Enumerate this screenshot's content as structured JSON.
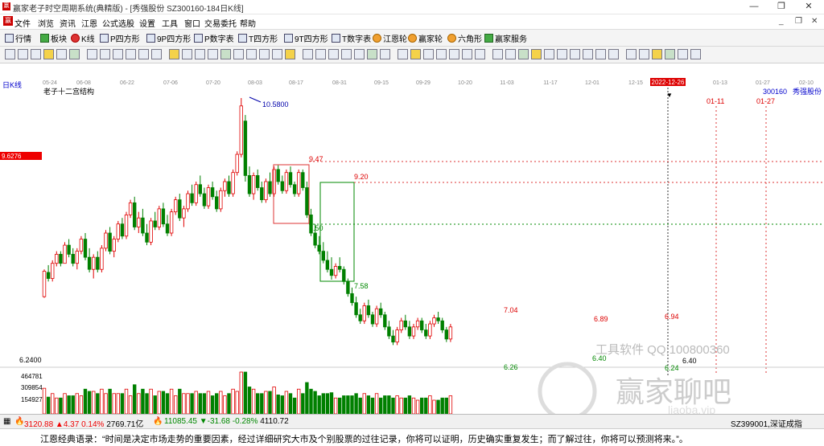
{
  "window": {
    "title": "赢家老子时空周期系统(典精版) - [秀强股份  SZ300160-184日K线]",
    "min_label": "—",
    "max_label": "❐",
    "close_label": "✕"
  },
  "menu": {
    "logo": "赢",
    "items": [
      "文件",
      "浏览",
      "资讯",
      "江恩",
      "公式选股",
      "设置",
      "工具",
      "窗口",
      "交易委托",
      "帮助"
    ]
  },
  "toolbar": {
    "buttons": [
      {
        "label": "行情",
        "icon": "grid-icon"
      },
      {
        "label": "板块",
        "icon": "blocks-icon"
      },
      {
        "label": "K线",
        "icon": "candles-icon"
      },
      {
        "label": "P四方形",
        "icon": "p-square-icon"
      },
      {
        "label": "9P四方形",
        "icon": "9p-square-icon"
      },
      {
        "label": "P数字表",
        "icon": "p-table-icon"
      },
      {
        "label": "T四方形",
        "icon": "t-square-icon"
      },
      {
        "label": "9T四方形",
        "icon": "9t-square-icon"
      },
      {
        "label": "T数字表",
        "icon": "t-table-icon"
      },
      {
        "label": "江恩轮",
        "icon": "gann-wheel-icon"
      },
      {
        "label": "赢家轮",
        "icon": "winner-wheel-icon"
      },
      {
        "label": "六角形",
        "icon": "hexagon-icon"
      },
      {
        "label": "赢家服务",
        "icon": "service-icon"
      }
    ]
  },
  "chart": {
    "period_label": "日K线",
    "structure_label": "老子十二宫结构",
    "stock_code": "300160",
    "stock_name": "秀强股份",
    "current_date_badge": "2022-12-26",
    "date_ticks": [
      "05-24",
      "06-08",
      "06-22",
      "07-06",
      "07-20",
      "08-03",
      "08-17",
      "08-31",
      "09-15",
      "09-29",
      "10-20",
      "11-03",
      "11-17",
      "12-01",
      "12-15",
      "2022-12-26",
      "01-13",
      "01-27",
      "02-10"
    ],
    "future_labels": [
      "01-11",
      "01-27"
    ],
    "left_price_badge": "9.6276",
    "left_low_label": "6.2400",
    "volume_labels": [
      "464781",
      "309854",
      "154927"
    ],
    "annotations": [
      "10.5800",
      "9.47",
      "9.20",
      "8.50",
      "7.58",
      "7.04",
      "6.89",
      "6.94",
      "6.26",
      "6.40",
      "6.24",
      "6.40"
    ],
    "watermark_text": "工具软件 QQ:100800360",
    "watermark_brand": "赢家聊吧",
    "watermark_url": "liaoba.vip"
  },
  "candles": [
    {
      "d": "05-24",
      "o": 7.3,
      "h": 7.75,
      "l": 7.28,
      "c": 7.72
    },
    {
      "d": "05-25",
      "o": 7.7,
      "h": 7.82,
      "l": 7.55,
      "c": 7.6
    },
    {
      "d": "05-26",
      "o": 7.6,
      "h": 7.9,
      "l": 7.55,
      "c": 7.85
    },
    {
      "d": "05-27",
      "o": 7.85,
      "h": 8.05,
      "l": 7.8,
      "c": 8.0
    },
    {
      "d": "05-30",
      "o": 8.0,
      "h": 8.05,
      "l": 7.8,
      "c": 7.85
    },
    {
      "d": "05-31",
      "o": 7.85,
      "h": 8.2,
      "l": 7.85,
      "c": 8.15
    },
    {
      "d": "06-01",
      "o": 8.15,
      "h": 8.25,
      "l": 7.95,
      "c": 8.0
    },
    {
      "d": "06-02",
      "o": 8.0,
      "h": 8.1,
      "l": 7.8,
      "c": 7.85
    },
    {
      "d": "06-06",
      "o": 7.85,
      "h": 8.1,
      "l": 7.75,
      "c": 8.05
    },
    {
      "d": "06-07",
      "o": 8.05,
      "h": 8.3,
      "l": 8.0,
      "c": 8.25
    },
    {
      "d": "06-08",
      "o": 8.25,
      "h": 8.35,
      "l": 7.9,
      "c": 7.95
    },
    {
      "d": "06-09",
      "o": 7.95,
      "h": 8.1,
      "l": 7.7,
      "c": 7.75
    },
    {
      "d": "06-10",
      "o": 7.75,
      "h": 8.0,
      "l": 7.6,
      "c": 7.95
    },
    {
      "d": "06-13",
      "o": 7.95,
      "h": 8.05,
      "l": 7.7,
      "c": 7.75
    },
    {
      "d": "06-14",
      "o": 7.75,
      "h": 8.15,
      "l": 7.7,
      "c": 8.1
    },
    {
      "d": "06-15",
      "o": 8.1,
      "h": 8.4,
      "l": 8.05,
      "c": 8.35
    },
    {
      "d": "06-16",
      "o": 8.35,
      "h": 8.45,
      "l": 8.0,
      "c": 8.05
    },
    {
      "d": "06-17",
      "o": 8.05,
      "h": 8.3,
      "l": 7.95,
      "c": 8.25
    },
    {
      "d": "06-20",
      "o": 8.25,
      "h": 8.55,
      "l": 8.2,
      "c": 8.5
    },
    {
      "d": "06-21",
      "o": 8.5,
      "h": 8.6,
      "l": 8.25,
      "c": 8.3
    },
    {
      "d": "06-22",
      "o": 8.3,
      "h": 8.7,
      "l": 8.25,
      "c": 8.65
    },
    {
      "d": "06-23",
      "o": 8.65,
      "h": 8.9,
      "l": 8.6,
      "c": 8.85
    },
    {
      "d": "06-24",
      "o": 8.85,
      "h": 8.95,
      "l": 8.4,
      "c": 8.45
    },
    {
      "d": "06-27",
      "o": 8.45,
      "h": 8.7,
      "l": 8.35,
      "c": 8.6
    },
    {
      "d": "06-28",
      "o": 8.6,
      "h": 8.75,
      "l": 8.3,
      "c": 8.35
    },
    {
      "d": "06-29",
      "o": 8.35,
      "h": 8.5,
      "l": 8.15,
      "c": 8.2
    },
    {
      "d": "06-30",
      "o": 8.2,
      "h": 8.6,
      "l": 8.15,
      "c": 8.55
    },
    {
      "d": "07-01",
      "o": 8.55,
      "h": 8.7,
      "l": 8.4,
      "c": 8.45
    },
    {
      "d": "07-04",
      "o": 8.45,
      "h": 8.8,
      "l": 8.4,
      "c": 8.75
    },
    {
      "d": "07-05",
      "o": 8.75,
      "h": 8.85,
      "l": 8.45,
      "c": 8.5
    },
    {
      "d": "07-06",
      "o": 8.5,
      "h": 8.65,
      "l": 8.3,
      "c": 8.35
    },
    {
      "d": "07-07",
      "o": 8.35,
      "h": 8.75,
      "l": 8.3,
      "c": 8.7
    },
    {
      "d": "07-08",
      "o": 8.7,
      "h": 8.95,
      "l": 8.65,
      "c": 8.9
    },
    {
      "d": "07-11",
      "o": 8.9,
      "h": 9.0,
      "l": 8.55,
      "c": 8.6
    },
    {
      "d": "07-12",
      "o": 8.6,
      "h": 8.8,
      "l": 8.45,
      "c": 8.75
    },
    {
      "d": "07-13",
      "o": 8.75,
      "h": 9.05,
      "l": 8.7,
      "c": 9.0
    },
    {
      "d": "07-14",
      "o": 9.0,
      "h": 9.15,
      "l": 8.8,
      "c": 8.85
    },
    {
      "d": "07-15",
      "o": 8.85,
      "h": 9.2,
      "l": 8.8,
      "c": 9.15
    },
    {
      "d": "07-18",
      "o": 9.15,
      "h": 9.3,
      "l": 8.95,
      "c": 9.0
    },
    {
      "d": "07-19",
      "o": 9.0,
      "h": 9.1,
      "l": 8.75,
      "c": 8.8
    },
    {
      "d": "07-20",
      "o": 8.8,
      "h": 9.15,
      "l": 8.75,
      "c": 9.1
    },
    {
      "d": "07-21",
      "o": 9.1,
      "h": 9.2,
      "l": 8.9,
      "c": 8.95
    },
    {
      "d": "07-22",
      "o": 8.95,
      "h": 9.05,
      "l": 8.7,
      "c": 8.75
    },
    {
      "d": "07-25",
      "o": 8.75,
      "h": 9.1,
      "l": 8.7,
      "c": 9.05
    },
    {
      "d": "07-26",
      "o": 9.05,
      "h": 9.25,
      "l": 8.95,
      "c": 9.2
    },
    {
      "d": "07-27",
      "o": 9.2,
      "h": 9.3,
      "l": 8.95,
      "c": 9.0
    },
    {
      "d": "07-28",
      "o": 9.0,
      "h": 9.4,
      "l": 8.95,
      "c": 9.35
    },
    {
      "d": "07-29",
      "o": 9.35,
      "h": 9.7,
      "l": 9.3,
      "c": 9.65
    },
    {
      "d": "08-01",
      "o": 9.65,
      "h": 10.58,
      "l": 9.6,
      "c": 10.45
    },
    {
      "d": "08-02",
      "o": 10.2,
      "h": 10.3,
      "l": 9.2,
      "c": 9.3
    },
    {
      "d": "08-03",
      "o": 9.3,
      "h": 9.45,
      "l": 8.95,
      "c": 9.0
    },
    {
      "d": "08-04",
      "o": 9.0,
      "h": 9.35,
      "l": 8.9,
      "c": 9.3
    },
    {
      "d": "08-05",
      "o": 9.3,
      "h": 9.4,
      "l": 9.05,
      "c": 9.1
    },
    {
      "d": "08-08",
      "o": 9.1,
      "h": 9.2,
      "l": 8.85,
      "c": 8.9
    },
    {
      "d": "08-09",
      "o": 8.9,
      "h": 9.25,
      "l": 8.85,
      "c": 9.2
    },
    {
      "d": "08-10",
      "o": 9.2,
      "h": 9.35,
      "l": 8.95,
      "c": 9.0
    },
    {
      "d": "08-11",
      "o": 9.0,
      "h": 9.45,
      "l": 8.95,
      "c": 9.4
    },
    {
      "d": "08-12",
      "o": 9.4,
      "h": 9.47,
      "l": 9.15,
      "c": 9.2
    },
    {
      "d": "08-15",
      "o": 9.2,
      "h": 9.3,
      "l": 9.0,
      "c": 9.05
    },
    {
      "d": "08-16",
      "o": 9.05,
      "h": 9.4,
      "l": 9.0,
      "c": 9.35
    },
    {
      "d": "08-17",
      "o": 9.35,
      "h": 9.45,
      "l": 9.1,
      "c": 9.15
    },
    {
      "d": "08-18",
      "o": 9.15,
      "h": 9.2,
      "l": 8.95,
      "c": 9.0
    },
    {
      "d": "08-19",
      "o": 9.0,
      "h": 9.4,
      "l": 8.95,
      "c": 9.35
    },
    {
      "d": "08-22",
      "o": 9.35,
      "h": 9.4,
      "l": 9.05,
      "c": 9.1
    },
    {
      "d": "08-23",
      "o": 9.1,
      "h": 9.2,
      "l": 8.6,
      "c": 8.65
    },
    {
      "d": "08-24",
      "o": 8.65,
      "h": 8.75,
      "l": 8.3,
      "c": 8.35
    },
    {
      "d": "08-25",
      "o": 8.35,
      "h": 8.5,
      "l": 8.1,
      "c": 8.15
    },
    {
      "d": "08-26",
      "o": 8.15,
      "h": 8.3,
      "l": 8.0,
      "c": 8.05
    },
    {
      "d": "08-29",
      "o": 8.05,
      "h": 8.2,
      "l": 7.85,
      "c": 7.9
    },
    {
      "d": "08-30",
      "o": 7.9,
      "h": 8.05,
      "l": 7.7,
      "c": 7.75
    },
    {
      "d": "08-31",
      "o": 7.75,
      "h": 7.95,
      "l": 7.58,
      "c": 7.65
    },
    {
      "d": "09-01",
      "o": 7.65,
      "h": 7.85,
      "l": 7.6,
      "c": 7.8
    },
    {
      "d": "09-02",
      "o": 7.8,
      "h": 7.95,
      "l": 7.7,
      "c": 7.75
    },
    {
      "d": "09-05",
      "o": 7.75,
      "h": 7.8,
      "l": 7.5,
      "c": 7.55
    },
    {
      "d": "09-06",
      "o": 7.55,
      "h": 7.6,
      "l": 7.3,
      "c": 7.35
    },
    {
      "d": "09-07",
      "o": 7.35,
      "h": 7.45,
      "l": 7.15,
      "c": 7.2
    },
    {
      "d": "09-08",
      "o": 7.2,
      "h": 7.3,
      "l": 6.95,
      "c": 7.0
    },
    {
      "d": "09-09",
      "o": 7.0,
      "h": 7.1,
      "l": 6.85,
      "c": 6.9
    },
    {
      "d": "09-13",
      "o": 6.9,
      "h": 7.2,
      "l": 6.85,
      "c": 7.15
    },
    {
      "d": "09-14",
      "o": 7.15,
      "h": 7.25,
      "l": 6.95,
      "c": 7.0
    },
    {
      "d": "09-15",
      "o": 7.0,
      "h": 7.05,
      "l": 6.8,
      "c": 6.85
    },
    {
      "d": "09-16",
      "o": 6.85,
      "h": 7.15,
      "l": 6.8,
      "c": 7.1
    },
    {
      "d": "09-19",
      "o": 7.1,
      "h": 7.2,
      "l": 6.95,
      "c": 7.0
    },
    {
      "d": "09-20",
      "o": 7.0,
      "h": 7.05,
      "l": 6.75,
      "c": 6.8
    },
    {
      "d": "09-21",
      "o": 6.8,
      "h": 6.9,
      "l": 6.6,
      "c": 6.65
    },
    {
      "d": "09-22",
      "o": 6.65,
      "h": 6.75,
      "l": 6.5,
      "c": 6.55
    },
    {
      "d": "09-23",
      "o": 6.55,
      "h": 6.8,
      "l": 6.5,
      "c": 6.75
    },
    {
      "d": "09-26",
      "o": 6.75,
      "h": 6.95,
      "l": 6.7,
      "c": 6.9
    },
    {
      "d": "09-27",
      "o": 6.9,
      "h": 7.0,
      "l": 6.75,
      "c": 6.8
    },
    {
      "d": "09-28",
      "o": 6.8,
      "h": 6.9,
      "l": 6.6,
      "c": 6.65
    },
    {
      "d": "09-29",
      "o": 6.65,
      "h": 6.85,
      "l": 6.6,
      "c": 6.8
    },
    {
      "d": "09-30",
      "o": 6.8,
      "h": 6.95,
      "l": 6.75,
      "c": 6.9
    },
    {
      "d": "10-10",
      "o": 6.9,
      "h": 6.95,
      "l": 6.7,
      "c": 6.75
    },
    {
      "d": "10-11",
      "o": 6.75,
      "h": 6.85,
      "l": 6.6,
      "c": 6.65
    },
    {
      "d": "10-12",
      "o": 6.65,
      "h": 6.9,
      "l": 6.6,
      "c": 6.85
    },
    {
      "d": "10-13",
      "o": 6.85,
      "h": 7.0,
      "l": 6.8,
      "c": 6.95
    },
    {
      "d": "10-14",
      "o": 6.95,
      "h": 7.05,
      "l": 6.85,
      "c": 6.9
    },
    {
      "d": "10-17",
      "o": 6.9,
      "h": 6.95,
      "l": 6.7,
      "c": 6.75
    },
    {
      "d": "10-18",
      "o": 6.75,
      "h": 6.8,
      "l": 6.55,
      "c": 6.6
    },
    {
      "d": "10-19",
      "o": 6.6,
      "h": 6.85,
      "l": 6.55,
      "c": 6.8
    }
  ]
}
